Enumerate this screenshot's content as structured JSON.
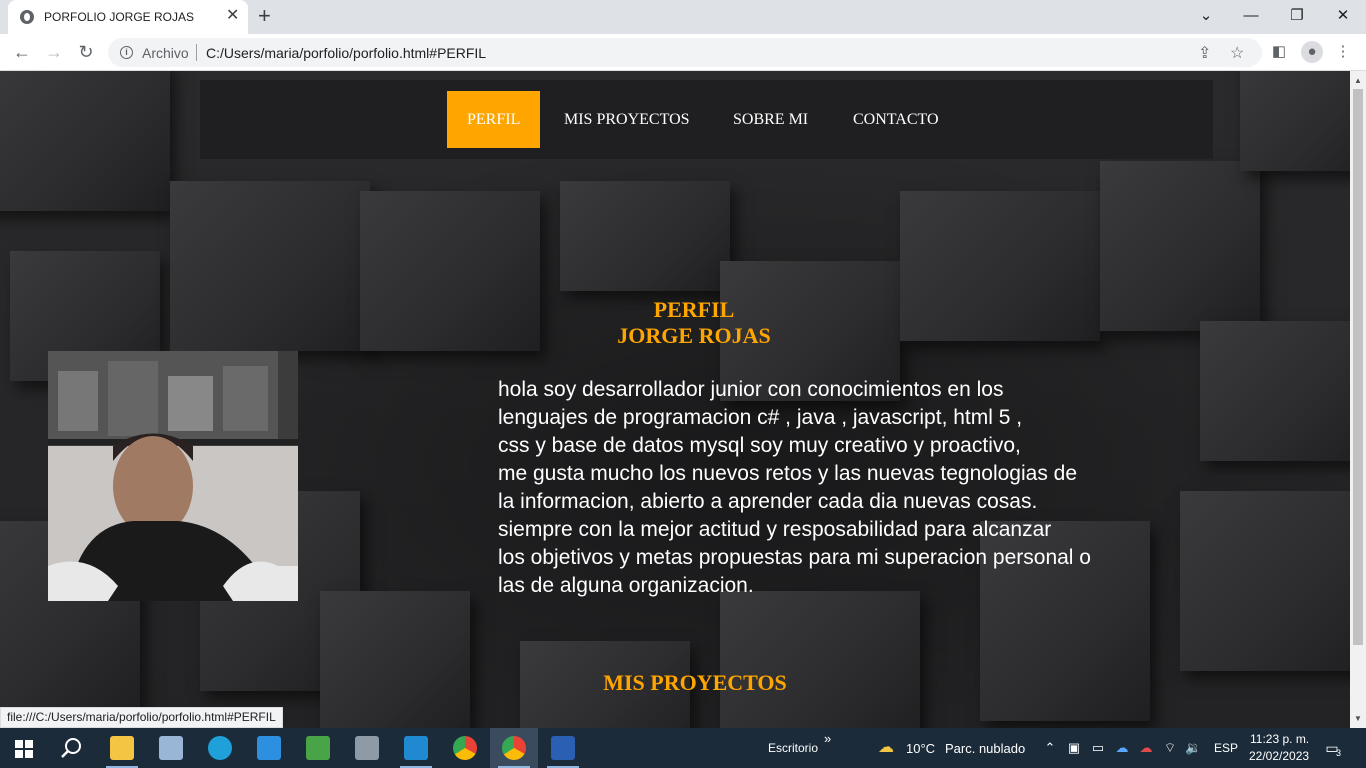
{
  "browser": {
    "tab_title": "PORFOLIO JORGE ROJAS",
    "tab_close": "✕",
    "new_tab": "+",
    "window_controls": {
      "dropdown": "⌄",
      "minimize": "—",
      "restore": "❐",
      "close": "✕"
    },
    "omnibox_label": "Archivo",
    "url": "C:/Users/maria/porfolio/porfolio.html#PERFIL",
    "status_url": "file:///C:/Users/maria/porfolio/porfolio.html#PERFIL"
  },
  "nav": {
    "items": [
      {
        "label": "PERFIL",
        "active": true
      },
      {
        "label": "MIS PROYECTOS",
        "active": false
      },
      {
        "label": "SOBRE MI",
        "active": false
      },
      {
        "label": "CONTACTO",
        "active": false
      }
    ]
  },
  "perfil": {
    "heading": "PERFIL",
    "name": "JORGE ROJAS",
    "bio_lines": [
      "hola soy desarrollador junior con conocimientos en los",
      "lenguajes de programacion c# , java , javascript, html 5 ,",
      "css y base de datos mysql soy muy creativo y proactivo,",
      "me gusta mucho los nuevos retos y las nuevas tegnologias de",
      "la informacion, abierto a aprender cada dia nuevas cosas.",
      "siempre con la mejor actitud y resposabilidad para alcanzar",
      "los objetivos y metas propuestas para mi superacion personal o",
      "las de alguna organizacion."
    ]
  },
  "proyectos": {
    "heading": "MIS PROYECTOS"
  },
  "colors": {
    "accent": "#ffa500",
    "taskbar": "#1c2b3a"
  },
  "taskbar": {
    "apps": [
      "windows-start",
      "search",
      "file-explorer",
      "photos",
      "edge",
      "mail",
      "app-green",
      "app-gray",
      "vscode",
      "chrome",
      "chrome-active",
      "word"
    ],
    "desktop_label": "Escritorio",
    "desktop_chevron": "»",
    "weather_temp": "10°C",
    "weather_desc": "Parc. nublado",
    "language": "ESP",
    "time": "11:23 p. m.",
    "date": "22/02/2023",
    "notifications": "3"
  }
}
